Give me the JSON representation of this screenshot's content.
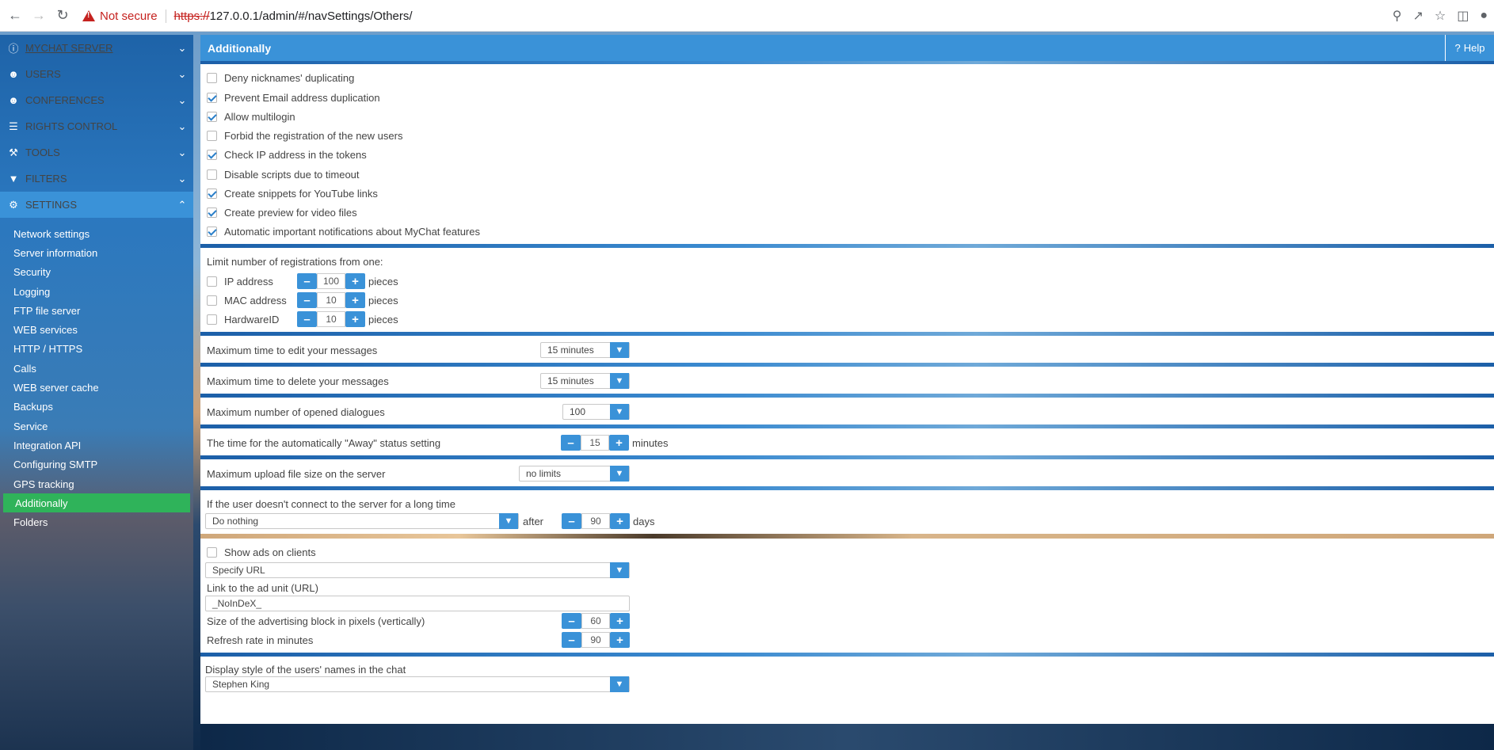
{
  "browser": {
    "warning": "Not secure",
    "url_scheme": "https://",
    "url_rest": "127.0.0.1/admin/#/navSettings/Others/"
  },
  "sidebar": {
    "top_items": [
      {
        "label": "MYCHAT SERVER",
        "icon": "info-icon"
      },
      {
        "label": "USERS",
        "icon": "users-icon"
      },
      {
        "label": "CONFERENCES",
        "icon": "conferences-icon"
      },
      {
        "label": "RIGHTS CONTROL",
        "icon": "list-icon"
      },
      {
        "label": "TOOLS",
        "icon": "wrench-icon"
      },
      {
        "label": "FILTERS",
        "icon": "filter-icon"
      },
      {
        "label": "SETTINGS",
        "icon": "gears-icon"
      }
    ],
    "settings_items": [
      "Network settings",
      "Server information",
      "Security",
      "Logging",
      "FTP file server",
      "WEB services",
      "HTTP / HTTPS",
      "Calls",
      "WEB server cache",
      "Backups",
      "Service",
      "Integration API",
      "Configuring SMTP",
      "GPS tracking",
      "Additionally",
      "Folders"
    ],
    "active_item": "Additionally"
  },
  "header": {
    "title": "Additionally",
    "help": "Help"
  },
  "checkboxes": [
    {
      "label": "Deny nicknames' duplicating",
      "checked": false
    },
    {
      "label": "Prevent Email address duplication",
      "checked": true
    },
    {
      "label": "Allow multilogin",
      "checked": true
    },
    {
      "label": "Forbid the registration of the new users",
      "checked": false
    },
    {
      "label": "Check IP address in the tokens",
      "checked": true
    },
    {
      "label": "Disable scripts due to timeout",
      "checked": false
    },
    {
      "label": "Create snippets for YouTube links",
      "checked": true
    },
    {
      "label": "Create preview for video files",
      "checked": true
    },
    {
      "label": "Automatic important notifications about MyChat features",
      "checked": true
    }
  ],
  "limit": {
    "title": "Limit number of registrations from one:",
    "rows": [
      {
        "label": "IP address",
        "value": "100",
        "unit": "pieces",
        "checked": false
      },
      {
        "label": "MAC address",
        "value": "10",
        "unit": "pieces",
        "checked": false
      },
      {
        "label": "HardwareID",
        "value": "10",
        "unit": "pieces",
        "checked": false
      }
    ]
  },
  "edit_time": {
    "label": "Maximum time to edit your messages",
    "value": "15 minutes"
  },
  "delete_time": {
    "label": "Maximum time to delete your messages",
    "value": "15 minutes"
  },
  "max_dialogues": {
    "label": "Maximum number of opened dialogues",
    "value": "100"
  },
  "away": {
    "label": "The time for the automatically \"Away\" status setting",
    "value": "15",
    "unit": "minutes"
  },
  "upload": {
    "label": "Maximum upload file size on the server",
    "value": "no limits"
  },
  "inactive": {
    "label": "If the user doesn't connect to the server for a long time",
    "action": "Do nothing",
    "after": "after",
    "value": "90",
    "unit": "days"
  },
  "ads": {
    "show_label": "Show ads on clients",
    "show_checked": false,
    "url_mode": "Specify URL",
    "link_label": "Link to the ad unit (URL)",
    "link_value": "_NoInDeX_",
    "size_label": "Size of the advertising block in pixels (vertically)",
    "size_value": "60",
    "refresh_label": "Refresh rate in minutes",
    "refresh_value": "90"
  },
  "display_style": {
    "label": "Display style of the users' names in the chat",
    "value": "Stephen King"
  }
}
